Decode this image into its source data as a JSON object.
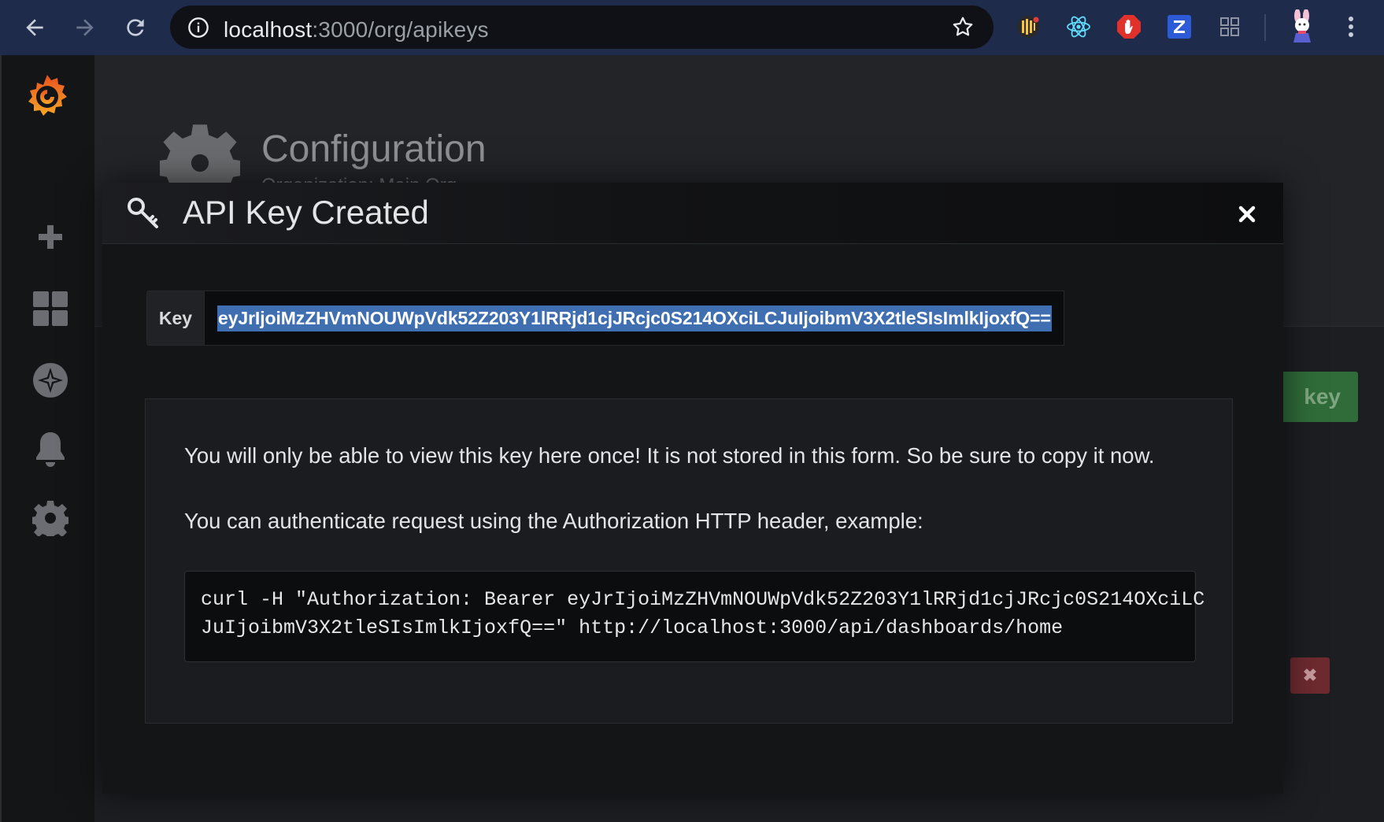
{
  "browser": {
    "url_host": "localhost",
    "url_path": ":3000/org/apikeys"
  },
  "page": {
    "title": "Configuration",
    "subtitle": "Organization: Main Org.",
    "bg_button_label": "key"
  },
  "modal": {
    "title": "API Key Created",
    "key_label": "Key",
    "key_value": "eyJrIjoiMzZHVmNOUWpVdk52Z203Y1lRRjd1cjJRcjc0S214OXciLCJuIjoibmV3X2tleSIsImlkIjoxfQ==",
    "info_line1": "You will only be able to view this key here once! It is not stored in this form. So be sure to copy it now.",
    "info_line2": "You can authenticate request using the Authorization HTTP header, example:",
    "code_line1": "curl -H \"Authorization: Bearer eyJrIjoiMzZHVmNOUWpVdk52Z203Y1lRRjd1cjJRcjc0S214OXciLC",
    "code_line2": "JuIjoibmV3X2tleSIsImlkIjoxfQ==\" http://localhost:3000/api/dashboards/home"
  },
  "colors": {
    "chrome_bg": "#1e2b4a",
    "selection": "#3f6fb1",
    "grafana_orange": "#f38b21"
  }
}
